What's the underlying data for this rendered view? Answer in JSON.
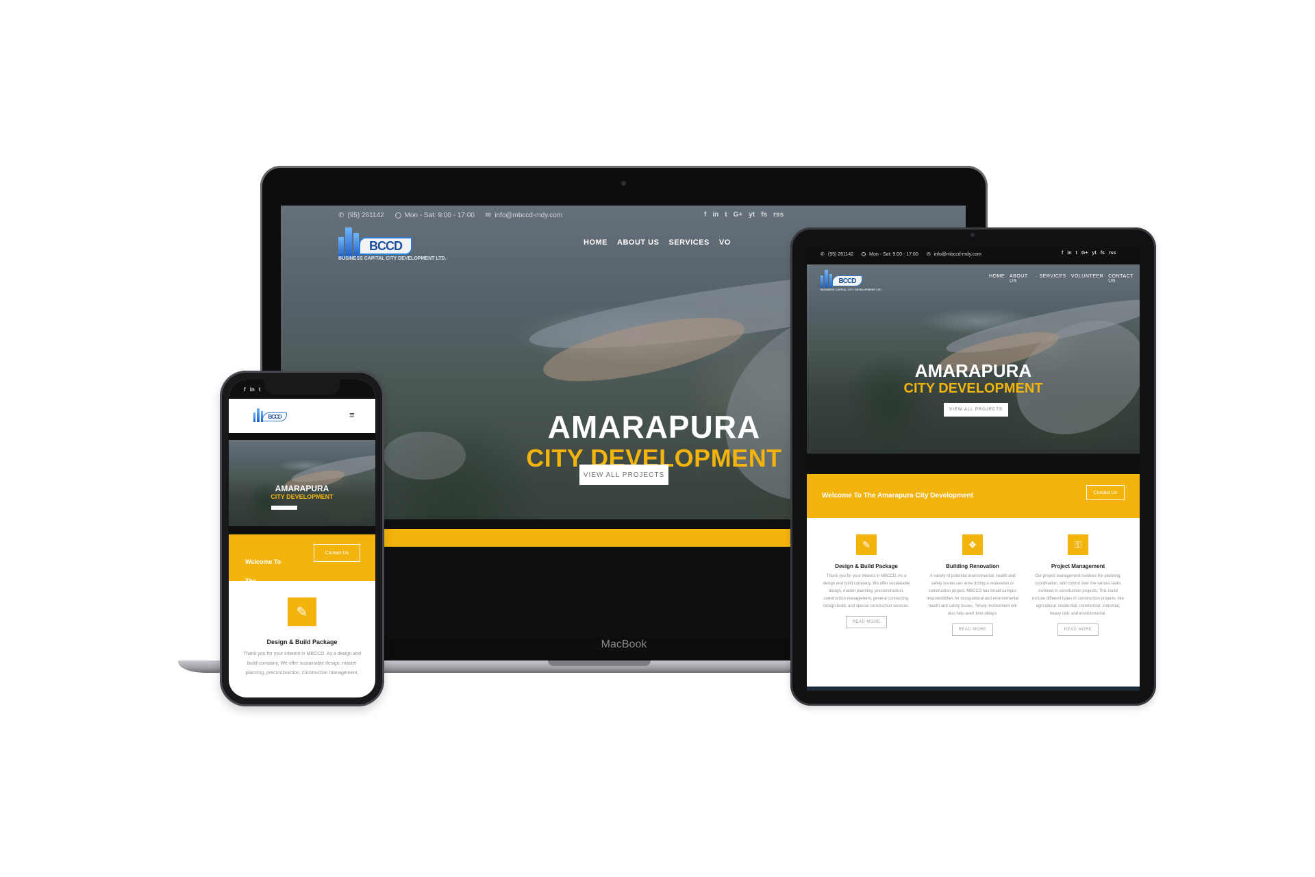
{
  "site": {
    "phone": "(95) 261142",
    "hours": "Mon - Sat: 9:00 - 17:00",
    "email": "info@mbccd-mdy.com",
    "logo_mark": "BCCD",
    "logo_tagline": "BUSINESS CAPITAL CITY DEVELOPMENT LTD.",
    "social": [
      "f",
      "in",
      "t",
      "G+",
      "yt",
      "fs",
      "rss"
    ],
    "nav": [
      "HOME",
      "ABOUT US",
      "SERVICES",
      "VOLUNTEER",
      "CONTACT US"
    ],
    "laptop_nav_visible": [
      "HOME",
      "ABOUT US",
      "SERVICES",
      "VO"
    ],
    "hero_title": "AMARAPURA",
    "hero_subtitle": "CITY DEVELOPMENT",
    "hero_button": "VIEW ALL PROJECTS",
    "welcome": "Welcome To The Amarapura City Development",
    "contact_button": "Contact Us",
    "features": [
      {
        "title": "Design  & Build Package",
        "body": "Thank you for your interest in MBCCD. As a design and build company, We offer sustainable design, master planning, preconstruction, construction management, general contracting, design-build, and special construction services.",
        "button": "READ MORE",
        "icon": "paintbrush-icon"
      },
      {
        "title": "Building Renovation",
        "body": "A variety of potential environmental, health and safety issues can arise during a renovation or construction project. MBCCD has broad campus responsibilities for occupational and environmental health and safety issues.  Timely involvement will also help avert time delays.",
        "button": "READ MORE",
        "icon": "cubes-icon"
      },
      {
        "title": "Project Management",
        "body": "Our project management involves the planning, coordination, and control over the various tasks involved in construction projects. This could include different types of construction projects, like agricultural, residential, commercial, industrial, heavy civil, and environmental.",
        "button": "READ MORE",
        "icon": "key-icon"
      }
    ],
    "phone_welcome_line1": "Welcome To",
    "phone_welcome_line2": "The",
    "phone_feature_body": "Thank you for your interest in MBCCD. As a design and build company, We offer sustainable design, master planning, preconstruction, construction management,",
    "phone_social": [
      "f",
      "in",
      "t"
    ],
    "menu_glyph": "≡"
  },
  "device": {
    "laptop_brand": "MacBook"
  },
  "colors": {
    "accent": "#f3b40d",
    "dark": "#0f1012"
  }
}
